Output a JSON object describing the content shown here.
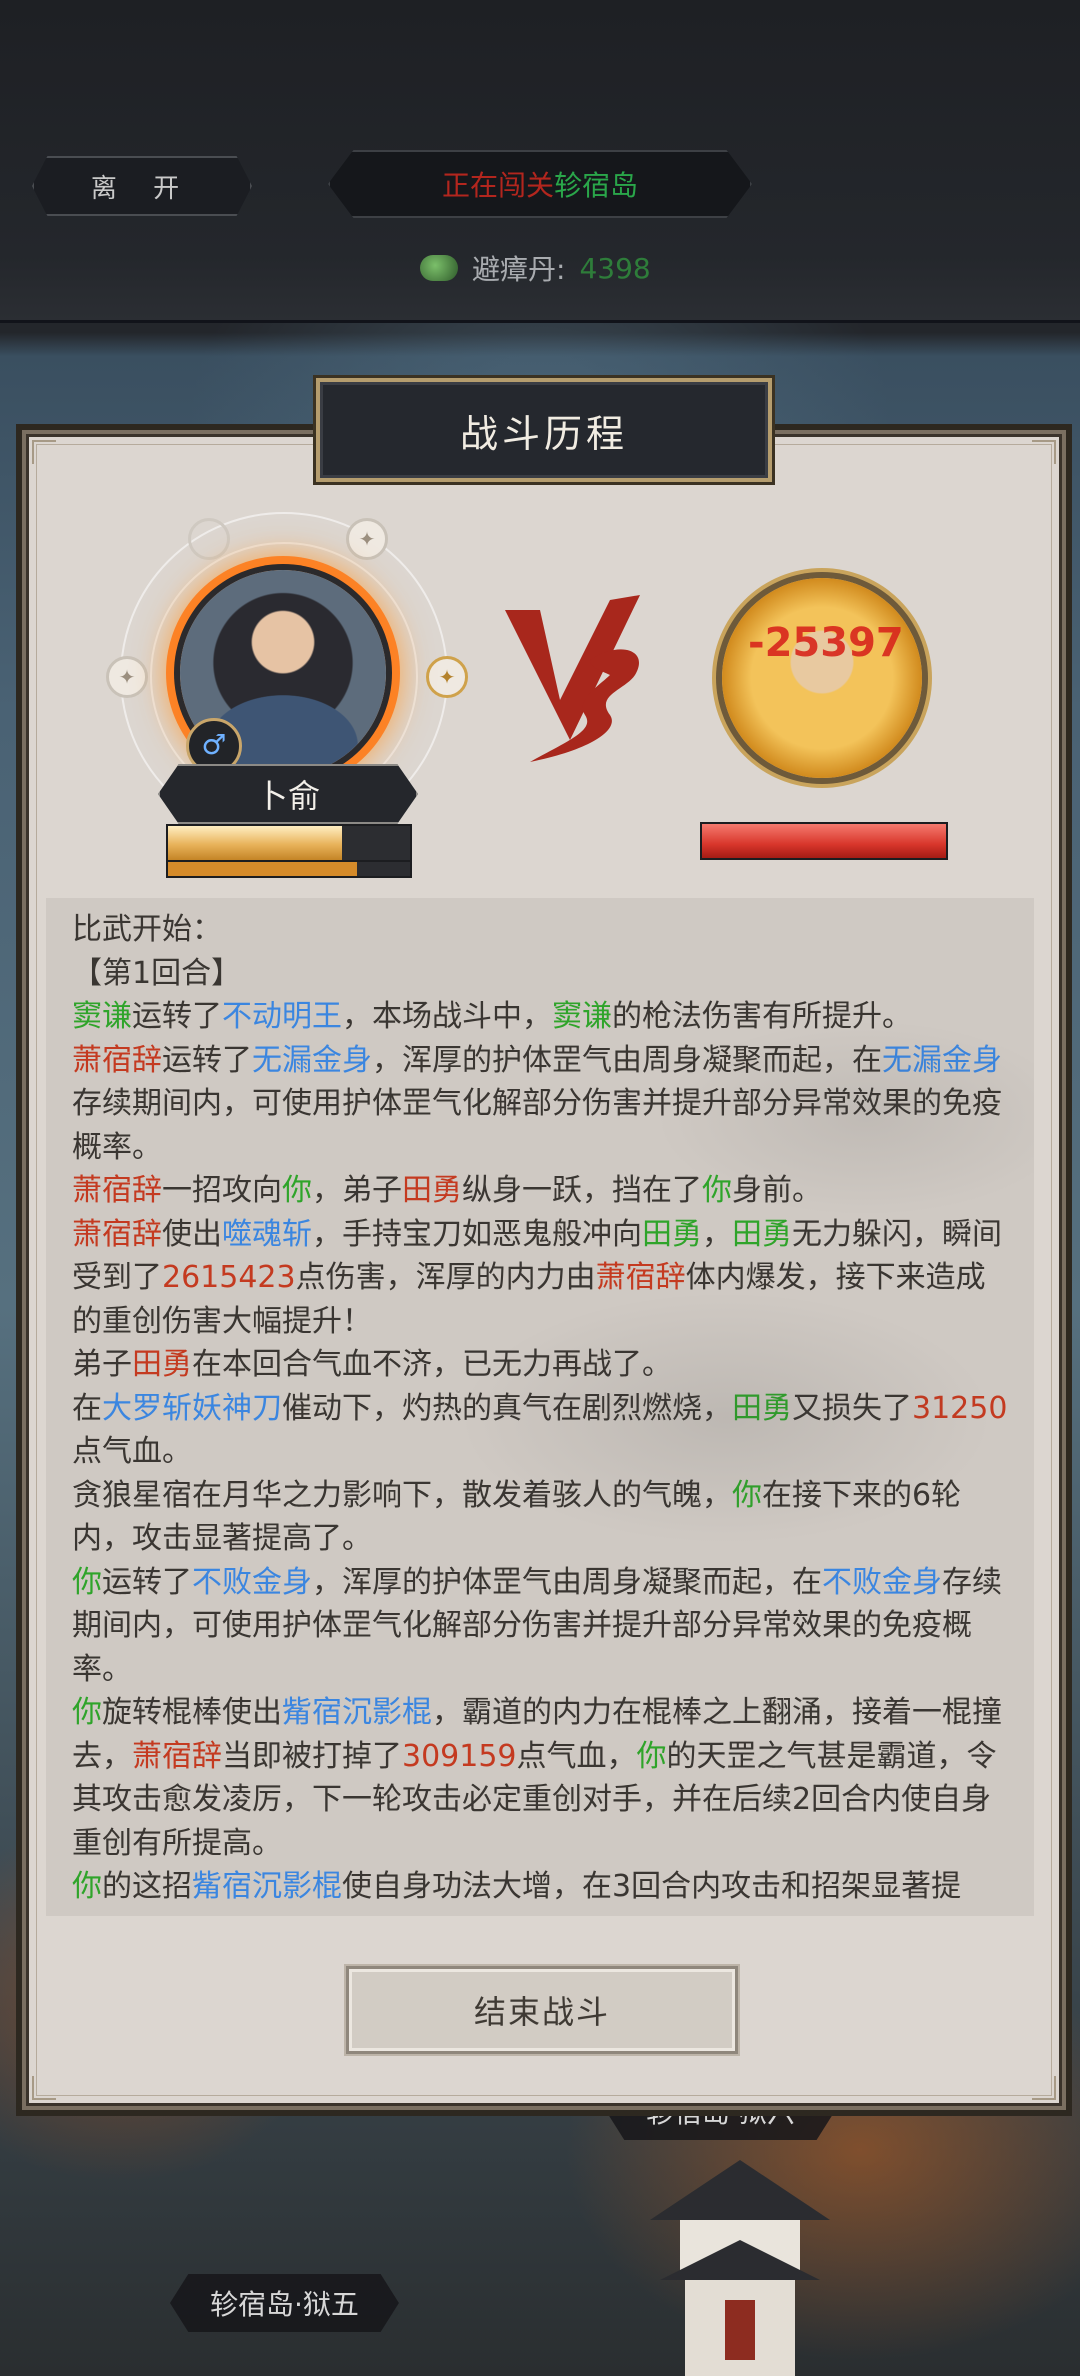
{
  "header": {
    "leave_label": "离 开",
    "status_prefix": "正在闯关",
    "status_location": "轸宿岛",
    "item_label": "避瘴丹:",
    "item_value": "4398"
  },
  "map_tags": {
    "tag6": "轸宿岛·狱六",
    "tag5": "轸宿岛·狱五"
  },
  "dialog": {
    "title": "战斗历程",
    "player_name": "卜俞",
    "gender_symbol": "♂",
    "player_hp_fraction": 0.72,
    "player_mp_fraction": 0.78,
    "enemy_hp_fraction": 1.0,
    "damage_number": "-25397",
    "end_button": "结束战斗"
  },
  "log": {
    "intro": "比武开始：",
    "round": "【第1回合】",
    "l1a": "窦谦",
    "l1b": "运转了",
    "l1c": "不动明王",
    "l1d": "，本场战斗中，",
    "l1e": "窦谦",
    "l1f": "的枪法伤害有所提升。",
    "l2a": "萧宿辞",
    "l2b": "运转了",
    "l2c": "无漏金身",
    "l2d": "，浑厚的护体罡气由周身凝聚而起，在",
    "l2e": "无漏金身",
    "l2f": "存续期间内，可使用护体罡气化解部分伤害并提升部分异常效果的免疫概率。",
    "l3a": "萧宿辞",
    "l3b": "一招攻向",
    "l3c": "你",
    "l3d": "，弟子",
    "l3e": "田勇",
    "l3f": "纵身一跃，挡在了",
    "l3g": "你",
    "l3h": "身前。",
    "l4a": "萧宿辞",
    "l4b": "使出",
    "l4c": "噬魂斩",
    "l4d": "，手持宝刀如恶鬼般冲向",
    "l4e": "田勇",
    "l4f": "，",
    "l4g": "田勇",
    "l4h": "无力躲闪，瞬间受到了",
    "l4i": "2615423",
    "l4j": "点伤害，浑厚的内力由",
    "l4k": "萧宿辞",
    "l4l": "体内爆发，接下来造成的重创伤害大幅提升！",
    "l5a": "弟子",
    "l5b": "田勇",
    "l5c": "在本回合气血不济，已无力再战了。",
    "l6a": "在",
    "l6b": "大罗斩妖神刀",
    "l6c": "催动下，灼热的真气在剧烈燃烧，",
    "l6d": "田勇",
    "l6e": "又损失了",
    "l6f": "31250",
    "l6g": "点气血。",
    "l7a": "贪狼星宿在月华之力影响下，散发着骇人的气魄，",
    "l7b": "你",
    "l7c": "在接下来的6轮内，攻击显著提高了。",
    "l8a": "你",
    "l8b": "运转了",
    "l8c": "不败金身",
    "l8d": "，浑厚的护体罡气由周身凝聚而起，在",
    "l8e": "不败金身",
    "l8f": "存续期间内，可使用护体罡气化解部分伤害并提升部分异常效果的免疫概率。",
    "l9a": "你",
    "l9b": "旋转棍棒使出",
    "l9c": "觜宿沉影棍",
    "l9d": "，霸道的内力在棍棒之上翻涌，接着一棍撞去，",
    "l9e": "萧宿辞",
    "l9f": "当即被打掉了",
    "l9g": "309159",
    "l9h": "点气血，",
    "l9i": "你",
    "l9j": "的天罡之气甚是霸道，令其攻击愈发凌厉，下一轮攻击必定重创对手，并在后续2回合内使自身重创有所提高。",
    "l10a": "你",
    "l10b": "的这招",
    "l10c": "觜宿沉影棍",
    "l10d": "使自身功法大增，在3回合内攻击和招架显著提"
  }
}
